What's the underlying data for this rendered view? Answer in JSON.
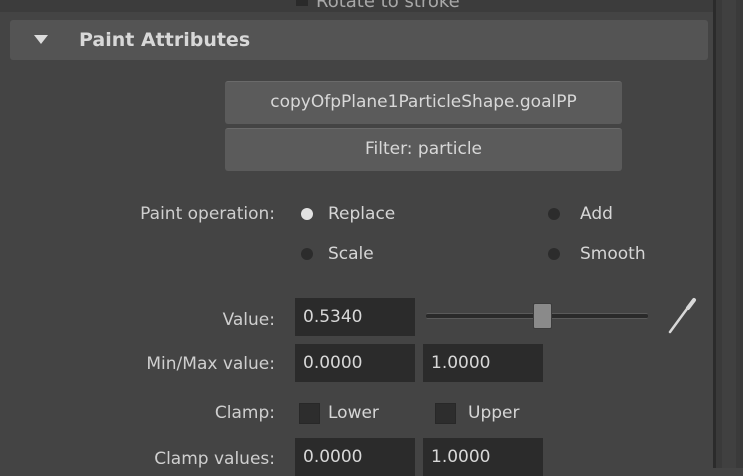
{
  "section": {
    "top_partial_label": "Rotate to stroke",
    "title": "Paint Attributes"
  },
  "attribute_button": "copyOfpPlane1ParticleShape.goalPP",
  "filter_button": "Filter: particle",
  "paint_operation": {
    "label": "Paint operation:",
    "options": [
      "Replace",
      "Add",
      "Scale",
      "Smooth"
    ],
    "selected": "Replace"
  },
  "value": {
    "label": "Value:",
    "value": "0.5340",
    "slider_fraction": 0.534
  },
  "min_max": {
    "label": "Min/Max value:",
    "min": "0.0000",
    "max": "1.0000"
  },
  "clamp": {
    "label": "Clamp:",
    "lower": "Lower",
    "upper": "Upper",
    "lower_checked": false,
    "upper_checked": false
  },
  "clamp_values": {
    "label": "Clamp values:",
    "min": "0.0000",
    "max": "1.0000"
  },
  "colors": {
    "background": "#444444",
    "header": "#545454",
    "field": "#2b2b2b",
    "radio_on": "#e2e2e2"
  },
  "icons": {
    "collapse": "triangle-down-icon",
    "picker": "eyedropper-icon"
  }
}
